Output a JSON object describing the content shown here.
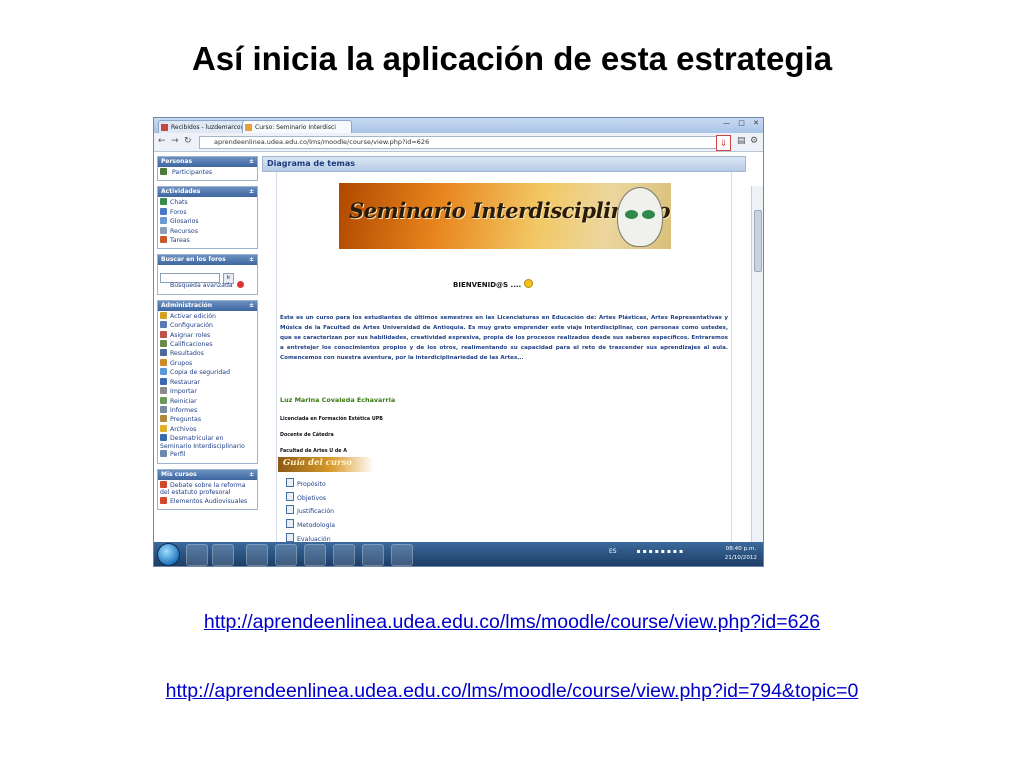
{
  "slide": {
    "title": "Así inicia la aplicación de esta estrategia",
    "links": [
      "http://aprendeenlinea.udea.edu.co/lms/moodle/course/view.php?id=626",
      "http://aprendeenlinea.udea.edu.co/lms/moodle/course/view.php?id=794&topic=0"
    ]
  },
  "browser": {
    "tabs": [
      {
        "label": "Recibidos - luzdemarco@g"
      },
      {
        "label": "Curso: Seminario Interdisci"
      }
    ],
    "url": "aprendeenlinea.udea.edu.co/lms/moodle/course/view.php?id=626"
  },
  "sidebar": {
    "personas": {
      "title": "Personas",
      "items": [
        {
          "label": "Participantes",
          "color": "#4a7a3a"
        }
      ]
    },
    "actividades": {
      "title": "Actividades",
      "items": [
        {
          "label": "Chats",
          "color": "#3a8a4a"
        },
        {
          "label": "Foros",
          "color": "#4a78c8"
        },
        {
          "label": "Glosarios",
          "color": "#6a9ad0"
        },
        {
          "label": "Recursos",
          "color": "#8aa0b8"
        },
        {
          "label": "Tareas",
          "color": "#c85a2a"
        }
      ]
    },
    "buscar": {
      "title": "Buscar en los foros",
      "advanced": "Búsqueda avanzada"
    },
    "administracion": {
      "title": "Administración",
      "items": [
        {
          "label": "Activar edición",
          "color": "#d4a020"
        },
        {
          "label": "Configuración",
          "color": "#5a7ab0"
        },
        {
          "label": "Asignar roles",
          "color": "#c0504a"
        },
        {
          "label": "Calificaciones",
          "color": "#6a8a4a"
        },
        {
          "label": "Resultados",
          "color": "#4a6a9a"
        },
        {
          "label": "Grupos",
          "color": "#d08a2a"
        },
        {
          "label": "Copia de seguridad",
          "color": "#5a9ad8"
        },
        {
          "label": "Restaurar",
          "color": "#3a6ab0"
        },
        {
          "label": "Importar",
          "color": "#8a8a8a"
        },
        {
          "label": "Reiniciar",
          "color": "#6a9a5a"
        },
        {
          "label": "Informes",
          "color": "#7a8aa0"
        },
        {
          "label": "Preguntas",
          "color": "#b08a3a"
        },
        {
          "label": "Archivos",
          "color": "#e0b02a"
        },
        {
          "label": "Desmatricular en Seminario Interdisciplinario",
          "color": "#3a6ab0"
        },
        {
          "label": "Perfil",
          "color": "#6a8ab0"
        }
      ]
    },
    "miscursos": {
      "title": "Mis cursos",
      "items": [
        {
          "label": "Debate sobre la reforma del estatuto profesoral",
          "color": "#d04a2a"
        },
        {
          "label": "Elementos Audiovisuales",
          "color": "#d04a2a"
        }
      ]
    }
  },
  "content": {
    "header": "Diagrama de temas",
    "banner": "Seminario Interdisciplinario",
    "welcome": "BIENVENID@S ....",
    "intro": "Este es un curso para los estudiantes de últimos semestres en las Licenciaturas en Educación de: Artes Plásticas, Artes Representativas y Música de la Facultad de Artes Universidad de Antioquia. Es muy grato emprender este viaje interdisciplinar, con personas como ustedes, que se caracterizan por sus habilidades, creatividad expresiva, propia de los procesos realizados desde sus saberes específicos. Entraremos a entretejer los conocimientos propios y de los otros, realimentando su capacidad para el reto de trascender sus aprendizajes al aula. Comencemos con nuestra aventura, por la interdiciplinariedad de las Artes...",
    "author": "Luz Marina Covaleda Echavarria",
    "credentials": [
      "Licenciada en Formación Estética UPB",
      "Docente de Cátedra",
      "Facultad de Artes U de A"
    ],
    "guide_title": "Guía del curso",
    "guide_items": [
      "Propósito",
      "Objetivos",
      "Justificación",
      "Metodología",
      "Evaluación"
    ]
  },
  "taskbar": {
    "language": "ES",
    "time": "08:40 p.m.",
    "date": "21/10/2012"
  }
}
